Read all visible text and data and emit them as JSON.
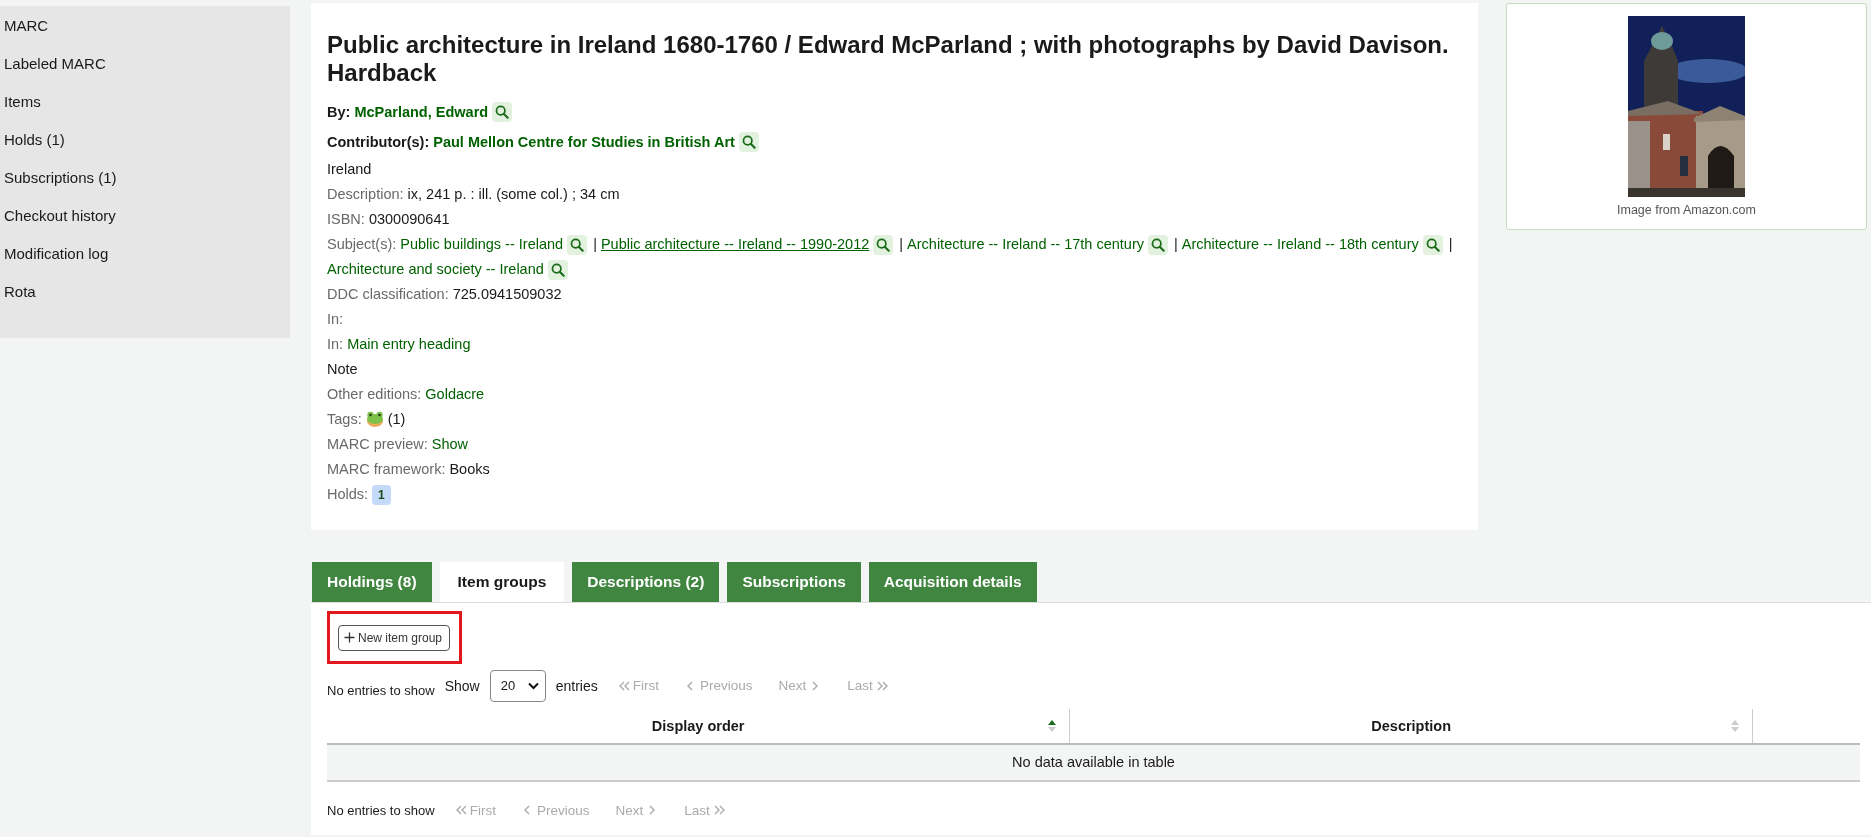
{
  "sidebar": {
    "items": [
      {
        "label": "MARC"
      },
      {
        "label": "Labeled MARC"
      },
      {
        "label": "Items"
      },
      {
        "label": "Holds (1)"
      },
      {
        "label": "Subscriptions (1)"
      },
      {
        "label": "Checkout history"
      },
      {
        "label": "Modification log"
      },
      {
        "label": "Rota"
      }
    ]
  },
  "record": {
    "title": "Public architecture in Ireland 1680-1760 / Edward McParland ; with photographs by David Davison. Hardback",
    "lines": [
      {
        "kind": "author",
        "label": "By:",
        "value": "McParland, Edward"
      },
      {
        "kind": "author",
        "label": "Contributor(s):",
        "value": "Paul Mellon Centre for Studies in British Art"
      },
      {
        "kind": "plain",
        "text": "Ireland"
      },
      {
        "kind": "field",
        "label": "Description:",
        "value": "ix, 241 p. : ill. (some col.) ; 34 cm",
        "link": false
      },
      {
        "kind": "field",
        "label": "ISBN:",
        "value": "0300090641",
        "link": false
      },
      {
        "kind": "subjects",
        "label": "Subject(s):",
        "items": [
          {
            "text": "Public buildings -- Ireland",
            "underlined": false
          },
          {
            "prefix": "|",
            "text": "Public architecture -- Ireland -- 1990-2012",
            "underlined": true
          },
          {
            "prefix": "|",
            "text": "Architecture -- Ireland -- 17th century",
            "underlined": false
          },
          {
            "prefix": "|",
            "text": "Architecture -- Ireland -- 18th century",
            "underlined": false
          },
          {
            "prefix": "|",
            "text": "Architecture and society -- Ireland",
            "underlined": false
          }
        ]
      },
      {
        "kind": "field",
        "label": "DDC classification:",
        "value": "725.0941509032",
        "link": false
      },
      {
        "kind": "field",
        "label": "In:"
      },
      {
        "kind": "field",
        "label": "In:",
        "value": "Main entry heading",
        "link": true
      },
      {
        "kind": "plain",
        "text": "Note"
      },
      {
        "kind": "field",
        "label": "Other editions:",
        "value": "Goldacre",
        "link": true
      },
      {
        "kind": "tags",
        "label": "Tags:",
        "count": "(1)"
      },
      {
        "kind": "field",
        "label": "MARC preview:",
        "value": "Show",
        "link": true
      },
      {
        "kind": "field",
        "label": "MARC framework:",
        "value": "Books",
        "link": false
      },
      {
        "kind": "badge",
        "label": "Holds:",
        "value": "1"
      }
    ]
  },
  "cover": {
    "kind": "picture",
    "caption": "Image from Amazon.com"
  },
  "tabs": [
    {
      "label": "Holdings (8)",
      "selected": false
    },
    {
      "label": "Item groups",
      "selected": true
    },
    {
      "label": "Descriptions (2)",
      "selected": false
    },
    {
      "label": "Subscriptions",
      "selected": false
    },
    {
      "label": "Acquisition details",
      "selected": false
    }
  ],
  "item_groups": {
    "new_button": {
      "label": "New item group",
      "highlighted": true
    },
    "top_controls": {
      "info": "No entries to show",
      "show_label": "Show",
      "page_size": "20",
      "entries_label": "entries",
      "pager": [
        {
          "kind": "first",
          "label": "First",
          "disabled": true
        },
        {
          "kind": "previous",
          "label": "Previous",
          "disabled": true
        },
        {
          "kind": "next",
          "label": "Next",
          "disabled": true
        },
        {
          "kind": "last",
          "label": "Last",
          "disabled": true
        }
      ]
    },
    "table": {
      "columns": [
        {
          "label": "Display order",
          "sorted_ascending": true
        },
        {
          "label": "Description",
          "sorted_ascending": false
        }
      ],
      "empty_message": "No data available in table"
    },
    "bottom_controls": {
      "info": "No entries to show",
      "pager": [
        {
          "kind": "first",
          "label": "First",
          "disabled": true
        },
        {
          "kind": "previous",
          "label": "Previous",
          "disabled": true
        },
        {
          "kind": "next",
          "label": "Next",
          "disabled": true
        },
        {
          "kind": "last",
          "label": "Last",
          "disabled": true
        }
      ]
    }
  }
}
